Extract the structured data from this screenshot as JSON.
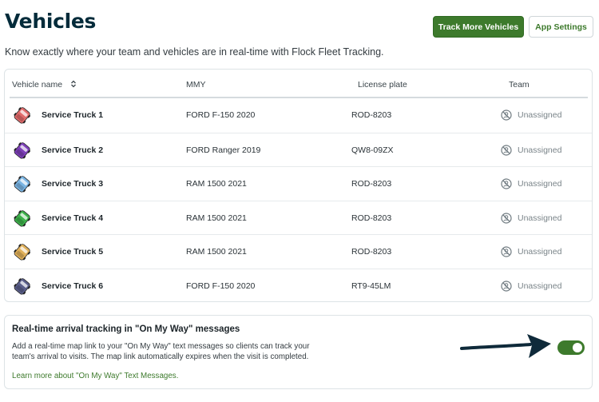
{
  "header": {
    "title": "Vehicles",
    "subtitle": "Know exactly where your team and vehicles are in real-time with Flock Fleet Tracking.",
    "track_more_label": "Track More Vehicles",
    "app_settings_label": "App Settings"
  },
  "table": {
    "columns": [
      "Vehicle name",
      "MMY",
      "License plate",
      "Team"
    ],
    "rows": [
      {
        "name": "Service Truck 1",
        "mmy": "FORD F-150 2020",
        "plate": "ROD-8203",
        "team": "Unassigned",
        "color": "#e06a6a"
      },
      {
        "name": "Service Truck 2",
        "mmy": "FORD Ranger 2019",
        "plate": "QW8-09ZX",
        "team": "Unassigned",
        "color": "#7d3fb8"
      },
      {
        "name": "Service Truck 3",
        "mmy": "RAM 1500 2021",
        "plate": "ROD-8203",
        "team": "Unassigned",
        "color": "#79b4e3"
      },
      {
        "name": "Service Truck  4",
        "mmy": "RAM 1500 2021",
        "plate": "ROD-8203",
        "team": "Unassigned",
        "color": "#3cb04a"
      },
      {
        "name": "Service Truck 5",
        "mmy": "RAM 1500 2021",
        "plate": "ROD-8203",
        "team": "Unassigned",
        "color": "#e0b05a"
      },
      {
        "name": "Service Truck 6",
        "mmy": "FORD F-150 2020",
        "plate": "RT9-45LM",
        "team": "Unassigned",
        "color": "#5a5f8a"
      }
    ]
  },
  "tracking": {
    "title": "Real-time arrival tracking in \"On My Way\" messages",
    "description": "Add a real-time map link to your \"On My Way\" text messages so clients can track your team's arrival to visits. The map link automatically expires when the visit is completed.",
    "link_label": "Learn more about \"On My Way\" Text Messages.",
    "enabled": true
  },
  "colors": {
    "brand_green": "#3d7a2c",
    "title_navy": "#032b3a",
    "arrow": "#0f2a3a"
  }
}
